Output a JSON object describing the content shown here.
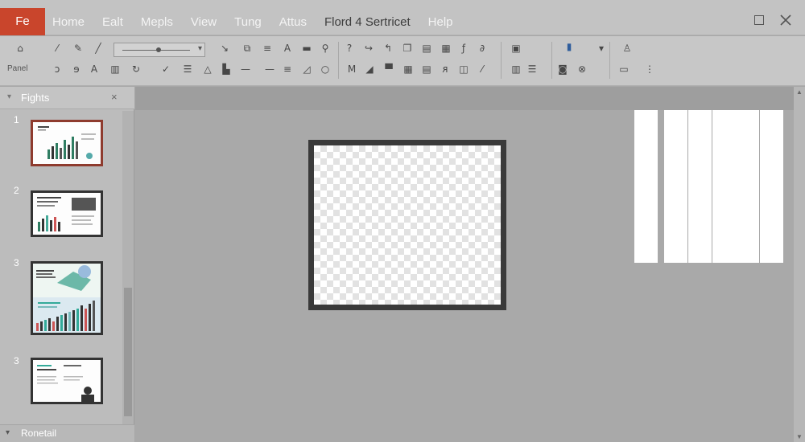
{
  "menubar": {
    "file_label": "Fe",
    "items": [
      "Home",
      "Ealt",
      "Mepls",
      "View",
      "Tung",
      "Attus",
      "Flord 4 Sertricet",
      "Help"
    ]
  },
  "ribbon": {
    "group_label": "Panel",
    "icons": [
      "paint-bucket",
      "pen",
      "pencil",
      "line",
      "undo",
      "redo",
      "font",
      "chart",
      "rotate",
      "align"
    ]
  },
  "slides_pane": {
    "title": "Fights",
    "footer_label": "Ronetail",
    "slides": [
      {
        "number": "1"
      },
      {
        "number": "2"
      },
      {
        "number": "3"
      },
      {
        "number": "3"
      }
    ]
  },
  "colors": {
    "file_tab": "#c9452c",
    "active_slide_border": "#8e3b2e",
    "canvas": "#a9a9a9"
  }
}
